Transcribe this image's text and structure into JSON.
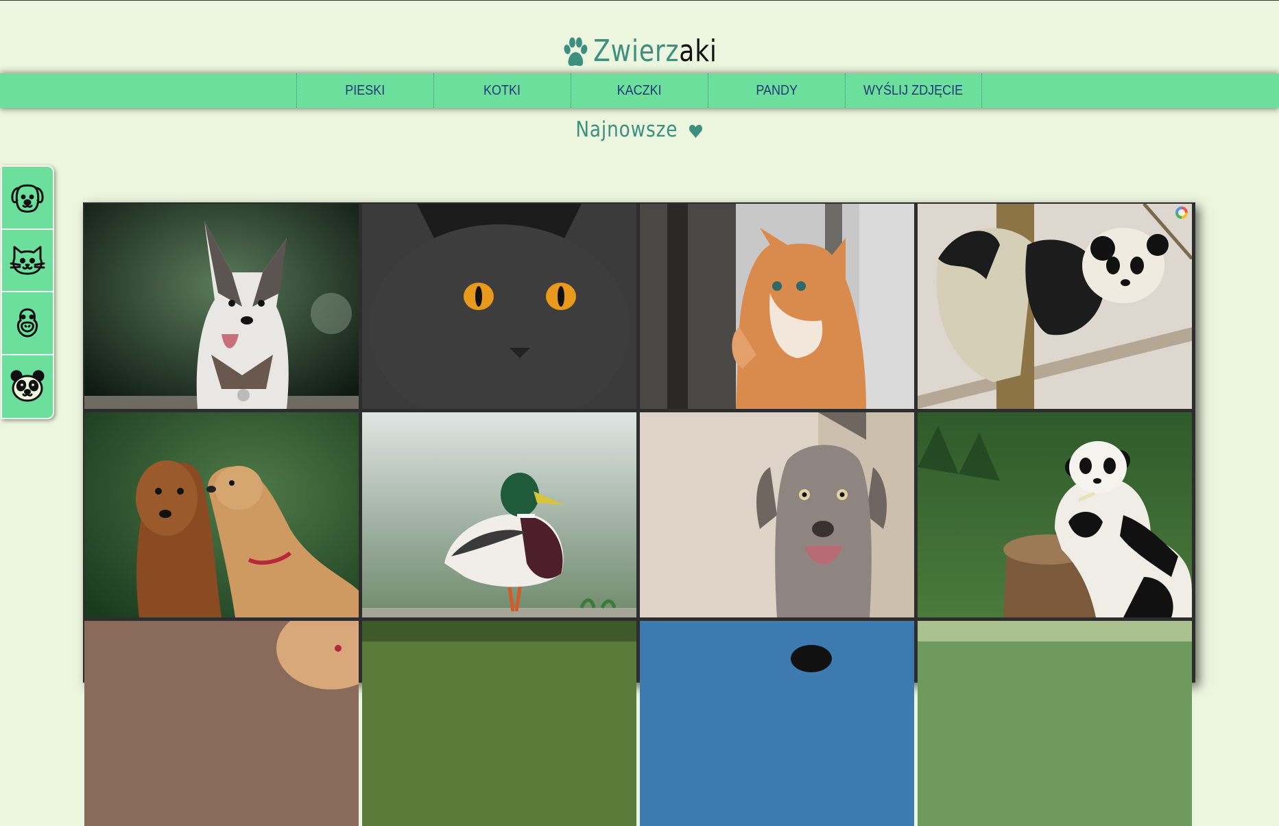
{
  "logo": {
    "part1": "Zwierz",
    "part2": "aki",
    "icon": "paw-icon"
  },
  "nav": {
    "items": [
      {
        "label": "PIESKI"
      },
      {
        "label": "KOTKI"
      },
      {
        "label": "KACZKI"
      },
      {
        "label": "PANDY"
      },
      {
        "label": "WYŚLIJ ZDJĘCIE"
      }
    ]
  },
  "section": {
    "title": "Najnowsze",
    "icon": "heart-icon"
  },
  "sidebar": {
    "items": [
      {
        "icon": "dog-face-icon"
      },
      {
        "icon": "cat-face-icon"
      },
      {
        "icon": "duck-face-icon"
      },
      {
        "icon": "panda-face-icon"
      }
    ]
  },
  "gallery": {
    "photos": [
      {
        "subject": "corgi dog"
      },
      {
        "subject": "black cat with orange eyes"
      },
      {
        "subject": "ginger kitten at window"
      },
      {
        "subject": "panda climbing tree in snow"
      },
      {
        "subject": "two golden retrievers"
      },
      {
        "subject": "mallard duck"
      },
      {
        "subject": "weimaraner dog"
      },
      {
        "subject": "panda on tree stump"
      },
      {
        "subject": "golden dog (partial)"
      },
      {
        "subject": "green field (partial)"
      },
      {
        "subject": "blue water (partial)"
      },
      {
        "subject": "greenery (partial)"
      }
    ]
  },
  "colors": {
    "background": "#ecf5de",
    "navbar": "#6ddf9d",
    "nav_text": "#1b3a75",
    "accent": "#3d8f7f"
  }
}
